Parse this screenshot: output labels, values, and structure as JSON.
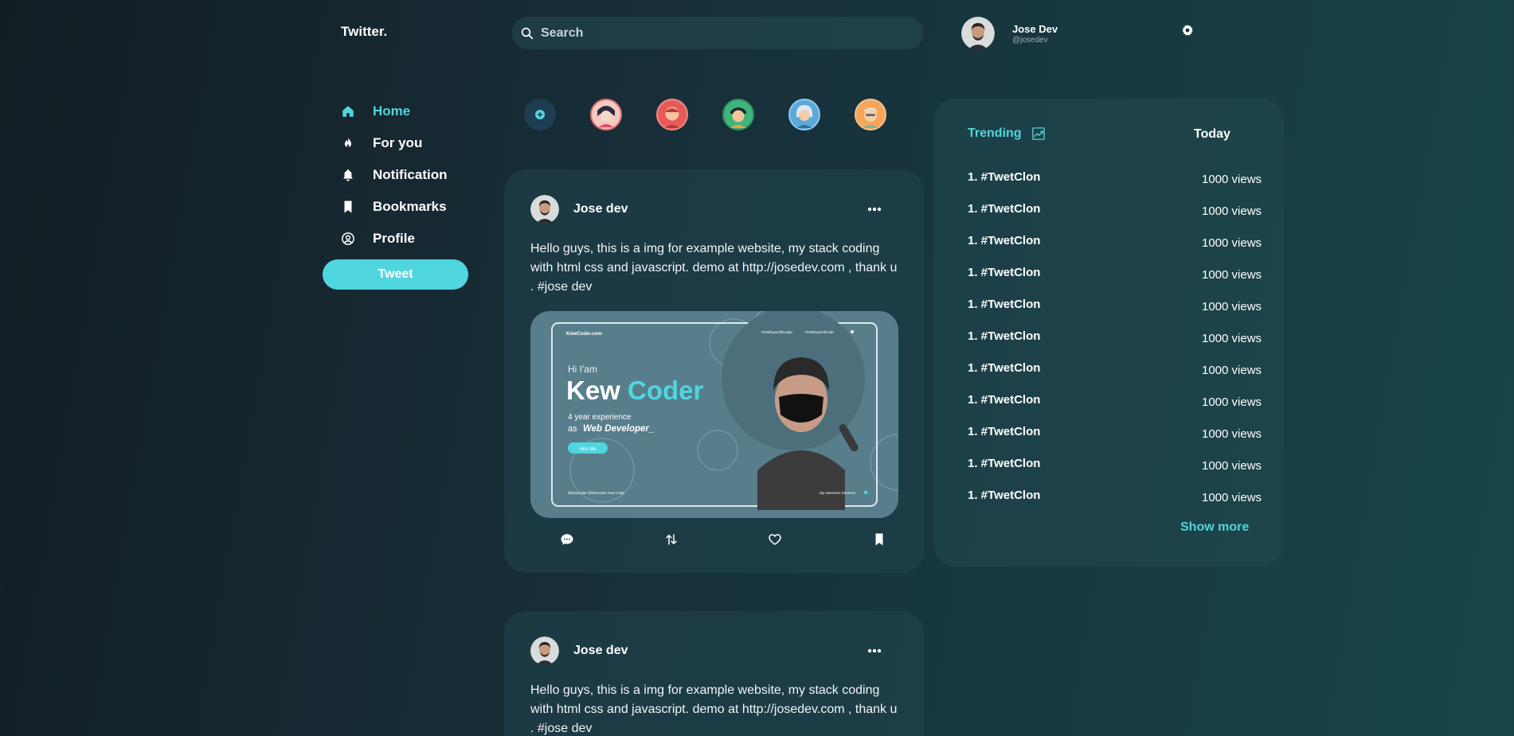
{
  "app": {
    "logo": "Twitter."
  },
  "search": {
    "placeholder": "Search"
  },
  "user": {
    "name": "Jose Dev",
    "handle": "@josedev"
  },
  "nav": {
    "items": [
      {
        "label": "Home",
        "icon": "home-icon",
        "active": true
      },
      {
        "label": "For you",
        "icon": "fire-icon"
      },
      {
        "label": "Notification",
        "icon": "bell-icon"
      },
      {
        "label": "Bookmarks",
        "icon": "bookmark-icon"
      },
      {
        "label": "Profile",
        "icon": "user-circle-icon"
      }
    ],
    "tweet_label": "Tweet"
  },
  "stories": {
    "add_icon": "plus-circle-icon",
    "avatars": [
      "story-avatar-1",
      "story-avatar-2",
      "story-avatar-3",
      "story-avatar-4",
      "story-avatar-5"
    ]
  },
  "posts": [
    {
      "author": "Jose dev",
      "text": "Hello guys, this is a img for example website, my stack coding with html css and javascript. demo at http://josedev.com , thank u . #jose dev",
      "image": {
        "site": "KewCode.com",
        "nav1": "#100DaysOfDesign",
        "nav2": "#100DaysOfCode",
        "greeting": "Hi I'am",
        "name_first": "Kew",
        "name_second": "Coder",
        "experience": "4 year experience",
        "role_prefix": "as",
        "role": "Web Developer_",
        "cta": "Hire Me",
        "footer_links": "@kewcoder   @kewcoder   Kew Code",
        "footer_right": "My Awesome Services"
      }
    },
    {
      "author": "Jose dev",
      "text": "Hello guys, this is a img for example website, my stack coding with html css and javascript. demo at http://josedev.com , thank u . #jose dev"
    }
  ],
  "trending": {
    "title": "Trending",
    "period": "Today",
    "items": [
      {
        "tag": "1. #TwetClon",
        "views": "1000 views"
      },
      {
        "tag": "1. #TwetClon",
        "views": "1000 views"
      },
      {
        "tag": "1. #TwetClon",
        "views": "1000 views"
      },
      {
        "tag": "1. #TwetClon",
        "views": "1000 views"
      },
      {
        "tag": "1. #TwetClon",
        "views": "1000 views"
      },
      {
        "tag": "1. #TwetClon",
        "views": "1000 views"
      },
      {
        "tag": "1. #TwetClon",
        "views": "1000 views"
      },
      {
        "tag": "1. #TwetClon",
        "views": "1000 views"
      },
      {
        "tag": "1. #TwetClon",
        "views": "1000 views"
      },
      {
        "tag": "1. #TwetClon",
        "views": "1000 views"
      },
      {
        "tag": "1. #TwetClon",
        "views": "1000 views"
      }
    ],
    "show_more": "Show more"
  },
  "colors": {
    "accent": "#52d4dc",
    "background_start": "#141d24",
    "background_end": "#174548",
    "card": "#20424c"
  }
}
